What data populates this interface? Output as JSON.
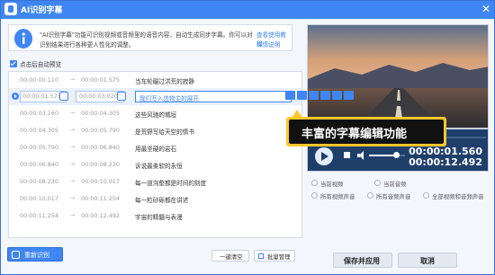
{
  "window": {
    "title": "AI识别字幕",
    "close_glyph": "✕"
  },
  "info": {
    "line1": "\"AI识别字幕\"功能可识别视频或音频里的语音内容，自动生成同步字幕。你可以对",
    "line2": "识别结果进行各种更人性化的调整。",
    "link1": "查看使用教程",
    "link2": "详情说明"
  },
  "autoplay": {
    "label": "点击后自动预览",
    "checked": true
  },
  "rows": [
    {
      "start": "00:00:00.110",
      "end": "00:00:01.575",
      "text": "当车轮碾过洪荒的寂静"
    },
    {
      "start": "00:00:01.575",
      "end": "00:00:03.020",
      "text": "我们写入造物主的展开",
      "active": true
    },
    {
      "start": "00:00:03.160",
      "end": "00:00:04.305",
      "text": "这些风驰的城垣"
    },
    {
      "start": "00:00:04.305",
      "end": "00:00:05.790",
      "text": "是荒野写给天空的情书"
    },
    {
      "start": "00:00:05.790",
      "end": "00:00:06.840",
      "text": "用最坚硬的岩石"
    },
    {
      "start": "00:00:06.840",
      "end": "00:00:08.230",
      "text": "诉说最柔软的永恒"
    },
    {
      "start": "00:00:08.230",
      "end": "00:00:10.017",
      "text": "每一道沟壑都是时间的刻度"
    },
    {
      "start": "00:00:10.017",
      "end": "00:00:11.254",
      "text": "每一粒砂砾都在讲述"
    },
    {
      "start": "00:00:11.254",
      "end": "00:00:12.492",
      "text": "宇宙的精髓与表漫"
    }
  ],
  "arrow": "→",
  "buttons": {
    "reidentify": "重新识别",
    "clear": "一键清空",
    "batch": "批量管理",
    "save": "保存并应用",
    "cancel": "取消"
  },
  "callout": "丰富的字幕编辑功能",
  "player": {
    "current": "00:00:01.560",
    "total": "00:00:12.492",
    "progress": 0.12,
    "volume": 0.75
  },
  "options": [
    {
      "label": "当前视频",
      "selected": false
    },
    {
      "label": "当前音频",
      "selected": false
    },
    {
      "label": "所有视频声音",
      "selected": false
    },
    {
      "label": "所有音频声音",
      "selected": false
    },
    {
      "label": "全部视频和音频声音",
      "selected": false
    }
  ],
  "colors": {
    "accent": "#3f86f2",
    "callout": "#ffc72c"
  }
}
